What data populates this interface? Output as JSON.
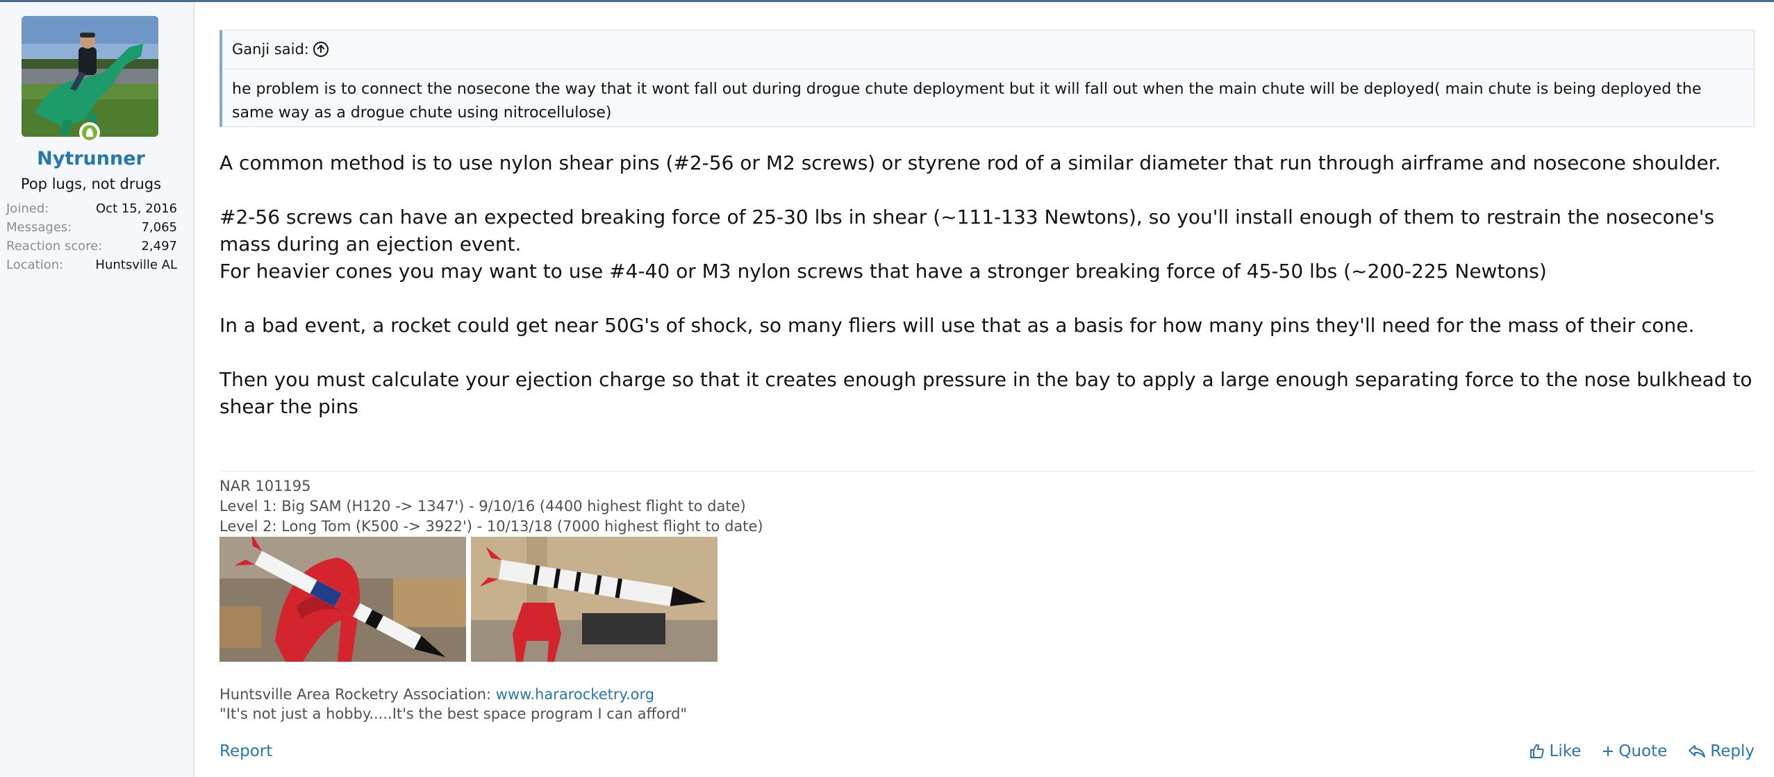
{
  "user": {
    "name": "Nytrunner",
    "title": "Pop lugs, not drugs",
    "stats": [
      {
        "label": "Joined:",
        "value": "Oct 15, 2016"
      },
      {
        "label": "Messages:",
        "value": "7,065"
      },
      {
        "label": "Reaction score:",
        "value": "2,497"
      },
      {
        "label": "Location:",
        "value": "Huntsville AL"
      }
    ],
    "avatar_icon": "avatar-photo",
    "online_icon": "online-user-icon"
  },
  "quote": {
    "title": "Ganji said:",
    "body": "he problem is to connect the nosecone the way that it wont fall out during drogue chute deployment but it will fall out when the main chute will be deployed( main chute is being deployed the same way as a drogue chute using nitrocellulose)"
  },
  "message": {
    "p1": "A common method is to use nylon shear pins (#2-56 or M2 screws) or styrene rod of a similar diameter that run through airframe and nosecone shoulder.",
    "p2": "#2-56 screws can have an expected breaking force of 25-30 lbs in shear (~111-133 Newtons), so you'll install enough of them to restrain the nosecone's mass during an ejection event.",
    "p3": "For heavier cones you may want to use #4-40 or M3 nylon screws that have a stronger breaking force of 45-50 lbs (~200-225 Newtons)",
    "p4": "In a bad event, a rocket could get near 50G's of shock, so many fliers will use that as a basis for how many pins they'll need for the mass of their cone.",
    "p5": "Then you must calculate your ejection charge so that it creates enough pressure in the bay to apply a large enough separating force to the nose bulkhead to shear the pins"
  },
  "signature": {
    "line1": "NAR 101195",
    "line2": "Level 1: Big SAM (H120 -> 1347') - 9/10/16 (4400 highest flight to date)",
    "line3": "Level 2: Long Tom (K500 -> 3922') - 10/13/18 (7000 highest flight to date)",
    "club_prefix": "Huntsville Area Rocketry Association: ",
    "club_link": "www.hararocketry.org",
    "motto": "\"It's not just a hobby.....It's the best space program I can afford\""
  },
  "actions": {
    "report": "Report",
    "like": "Like",
    "quote": "Quote",
    "reply": "Reply"
  },
  "colors": {
    "link": "#2577b1",
    "sidebar_bg": "#f5f7fa",
    "quote_bg": "#f7f9fb",
    "online": "#7bb43a"
  }
}
